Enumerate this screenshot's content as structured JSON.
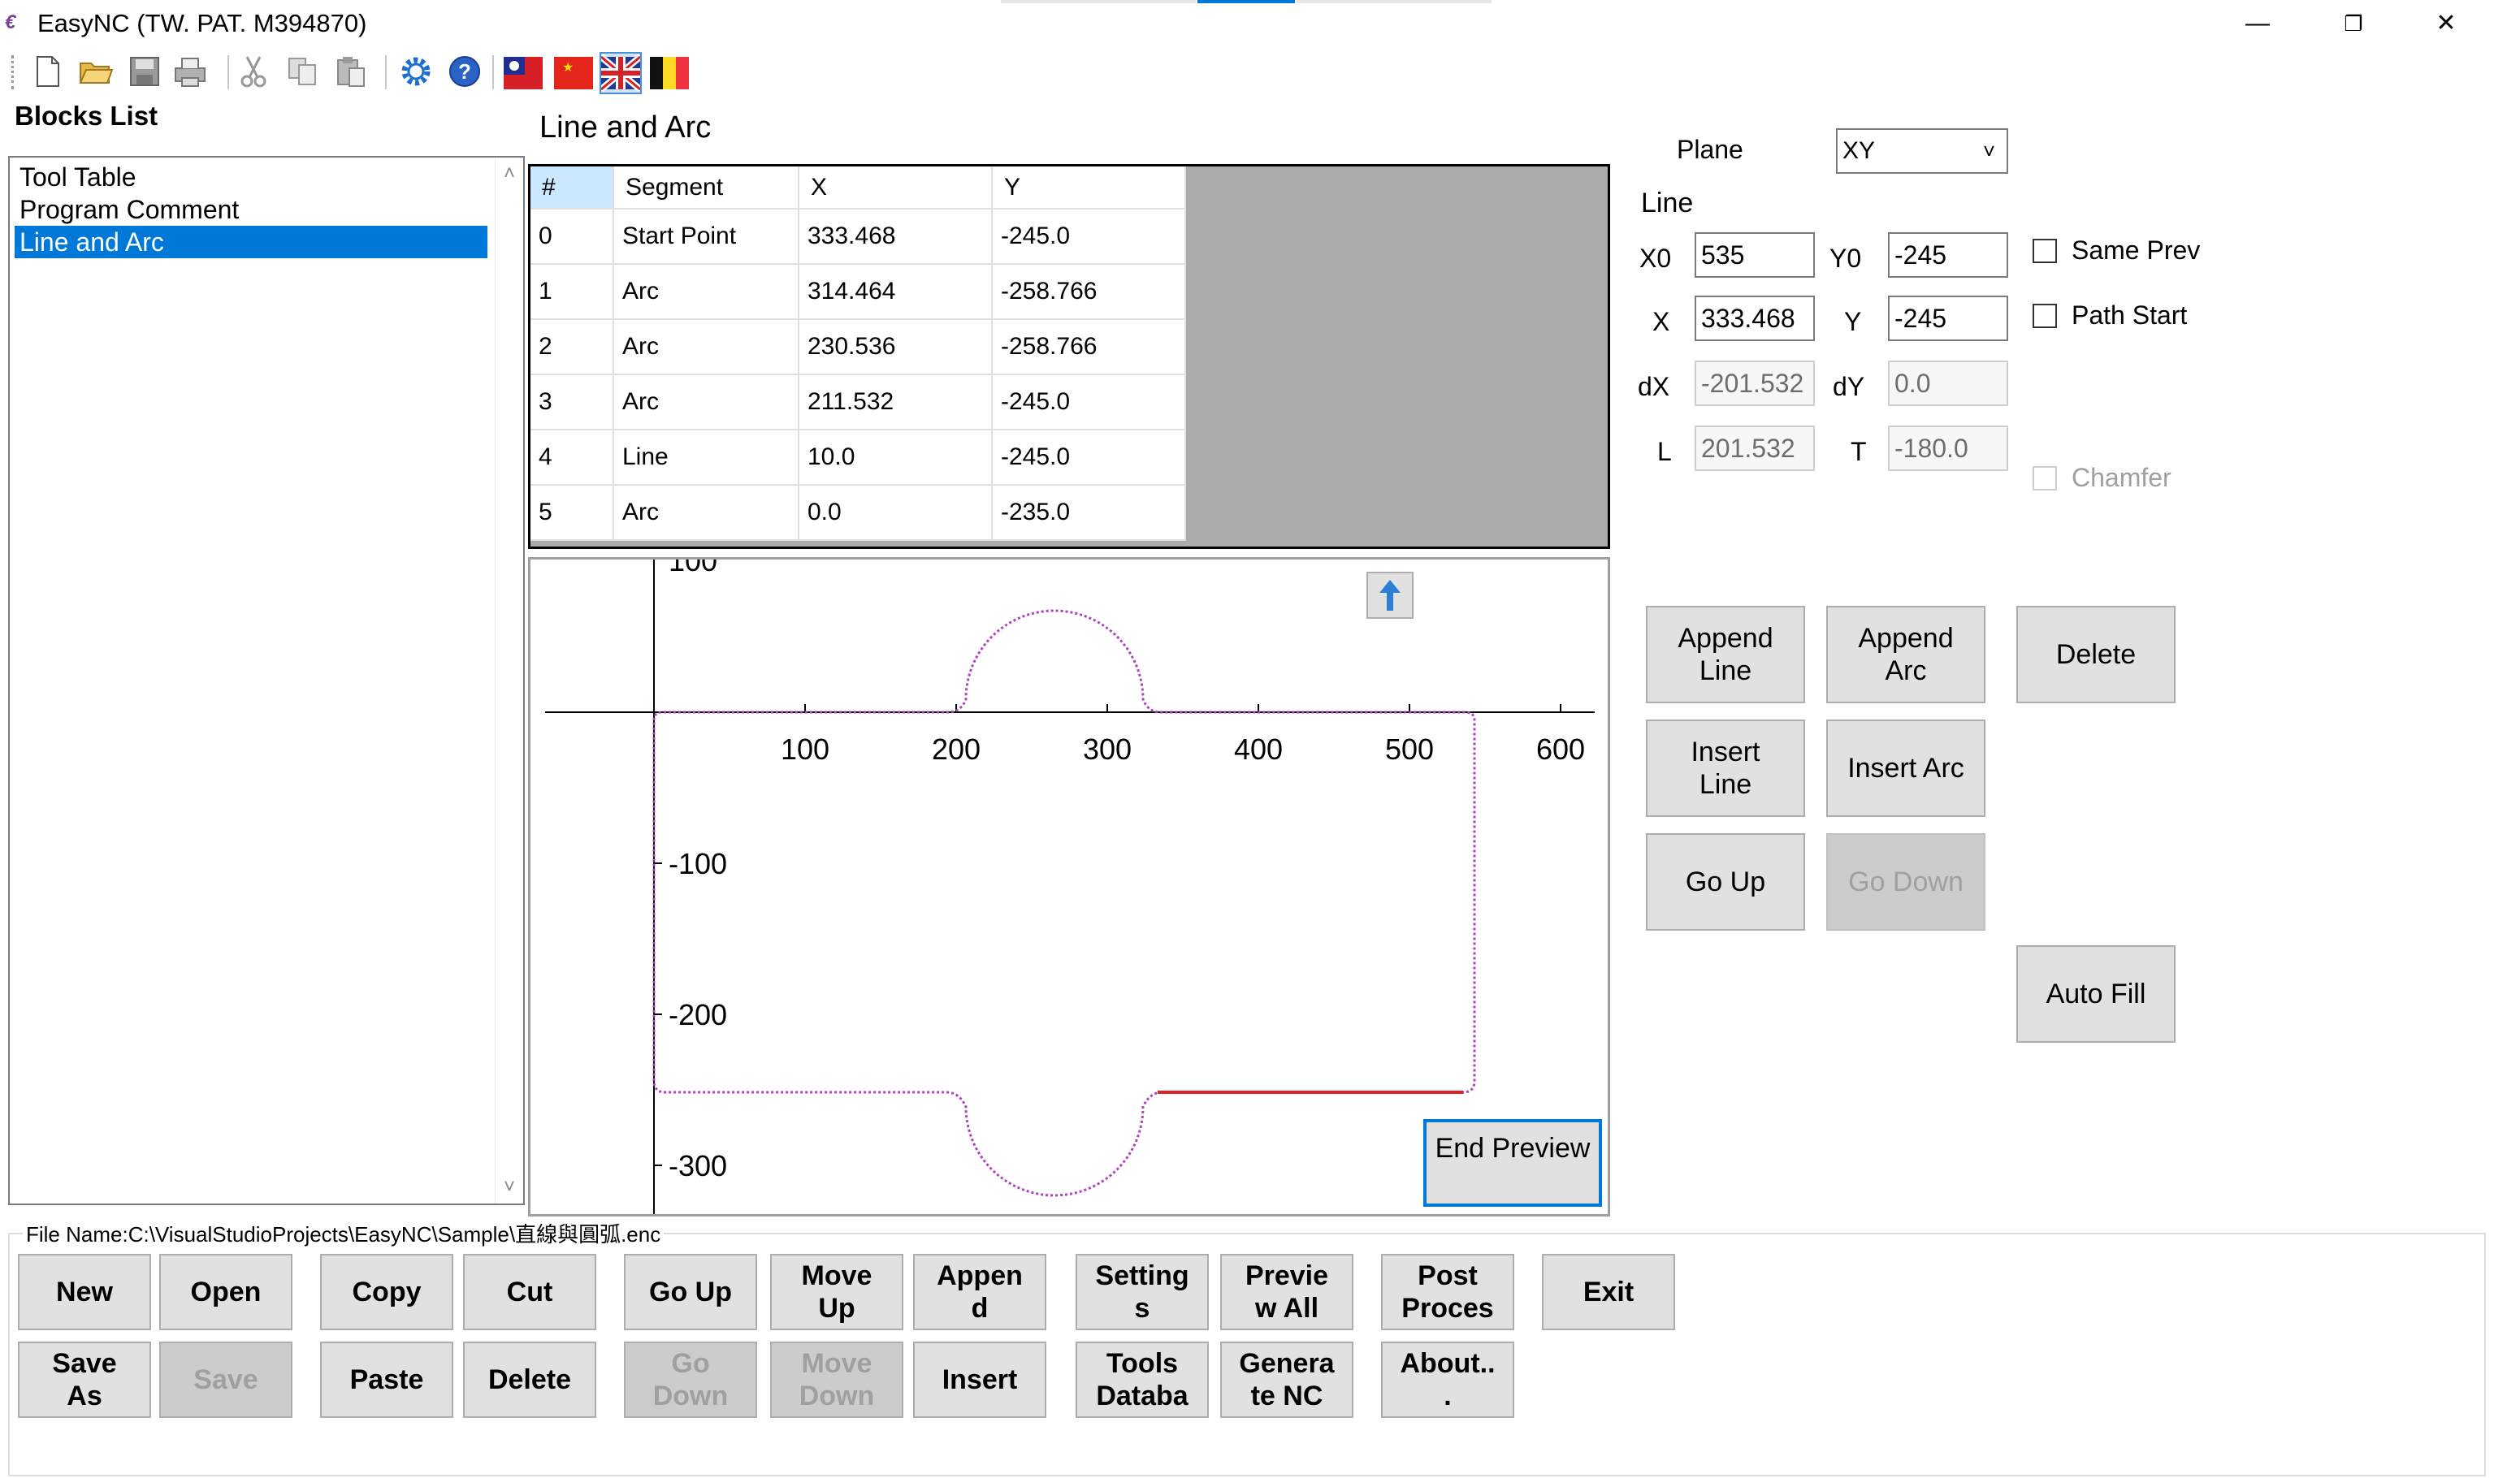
{
  "window": {
    "title": "EasyNC  (TW. PAT. M394870)",
    "minimize_glyph": "—",
    "restore_glyph": "❐",
    "close_glyph": "✕"
  },
  "toolbar": {
    "icons": [
      "new-file-icon",
      "open-folder-icon",
      "save-disk-icon",
      "print-icon",
      "cut-scissors-icon",
      "copy-icon",
      "paste-icon",
      "settings-gear-icon",
      "help-icon",
      "flag-taiwan-icon",
      "flag-china-icon",
      "flag-uk-icon",
      "flag-belgium-icon"
    ]
  },
  "blocks": {
    "title": "Blocks List",
    "items": [
      "Tool Table",
      "Program Comment",
      "Line and Arc"
    ],
    "selected_index": 2
  },
  "section_title": "Line and Arc",
  "grid": {
    "headers": [
      "#",
      "Segment",
      "X",
      "Y"
    ],
    "rows": [
      [
        "0",
        "Start Point",
        "333.468",
        "-245.0"
      ],
      [
        "1",
        "Arc",
        "314.464",
        "-258.766"
      ],
      [
        "2",
        "Arc",
        "230.536",
        "-258.766"
      ],
      [
        "3",
        "Arc",
        "211.532",
        "-245.0"
      ],
      [
        "4",
        "Line",
        "10.0",
        "-245.0"
      ],
      [
        "5",
        "Arc",
        "0.0",
        "-235.0"
      ]
    ]
  },
  "preview": {
    "x_ticks": [
      "100",
      "200",
      "300",
      "400",
      "500",
      "600"
    ],
    "y_ticks": [
      "100",
      "-100",
      "-200",
      "-300"
    ],
    "end_preview_label": "End Preview",
    "path_color": "#b040c0",
    "active_segment_color": "#e02020"
  },
  "props": {
    "plane_label": "Plane",
    "plane_value": "XY",
    "group_label": "Line",
    "x0_label": "X0",
    "x0_value": "535",
    "y0_label": "Y0",
    "y0_value": "-245",
    "x_label": "X",
    "x_value": "333.468",
    "y_label": "Y",
    "y_value": "-245",
    "dx_label": "dX",
    "dx_value": "-201.532",
    "dy_label": "dY",
    "dy_value": "0.0",
    "l_label": "L",
    "l_value": "201.532",
    "t_label": "T",
    "t_value": "-180.0",
    "same_prev": "Same Prev",
    "path_start": "Path Start",
    "chamfer": "Chamfer"
  },
  "actions": {
    "append_line": [
      "Append",
      "Line"
    ],
    "append_arc": [
      "Append",
      "Arc"
    ],
    "delete": "Delete",
    "insert_line": [
      "Insert",
      "Line"
    ],
    "insert_arc": "Insert Arc",
    "go_up": "Go Up",
    "go_down": "Go Down",
    "auto_fill": "Auto Fill"
  },
  "file_name": "File Name:C:\\VisualStudioProjects\\EasyNC\\Sample\\直線與圓弧.enc",
  "bottom": {
    "new": "New",
    "open": "Open",
    "copy": "Copy",
    "cut": "Cut",
    "go_up": "Go Up",
    "move_up": [
      "Move",
      "Up"
    ],
    "append": [
      "Appen",
      "d"
    ],
    "settings": [
      "Setting",
      "s"
    ],
    "preview_all": [
      "Previe",
      "w All"
    ],
    "post_process": [
      "Post",
      "Proces"
    ],
    "exit": "Exit",
    "save_as": [
      "Save",
      "As"
    ],
    "save": "Save",
    "paste": "Paste",
    "delete": "Delete",
    "go_down": [
      "Go",
      "Down"
    ],
    "move_down": [
      "Move",
      "Down"
    ],
    "insert": "Insert",
    "tools_db": [
      "Tools",
      "Databa"
    ],
    "generate_nc": [
      "Genera",
      "te NC"
    ],
    "about": [
      "About..",
      "."
    ]
  }
}
